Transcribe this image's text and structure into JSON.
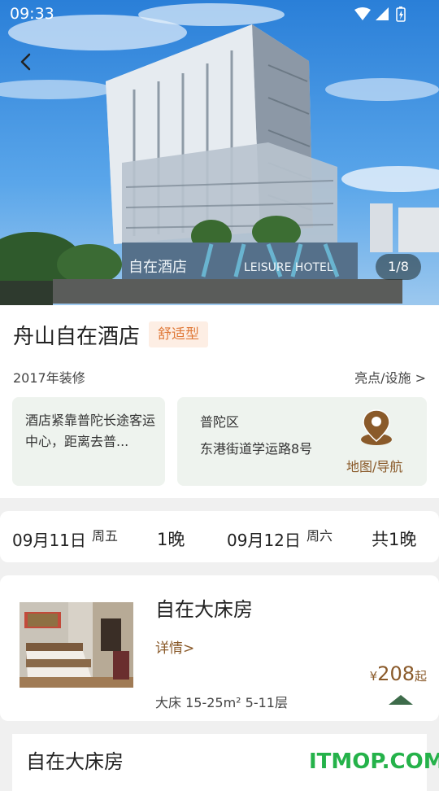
{
  "status_bar": {
    "time": "09:33"
  },
  "hero": {
    "photo_counter": "1/8",
    "sign_left": "自在酒店",
    "sign_right": "LEISURE HOTEL"
  },
  "hotel": {
    "name": "舟山自在酒店",
    "tag": "舒适型",
    "renovation": "2017年装修",
    "facilities_link": "亮点/设施 >",
    "description": "酒店紧靠普陀长途客运中心，距离去普...",
    "district": "普陀区",
    "street": "东港街道学运路8号",
    "map_label": "地图/导航"
  },
  "dates": {
    "checkin_date": "09月11日",
    "checkin_weekday": "周五",
    "nights": "1晚",
    "checkout_date": "09月12日",
    "checkout_weekday": "周六",
    "total": "共1晚"
  },
  "rooms": [
    {
      "name": "自在大床房",
      "detail_link": "详情>",
      "currency": "¥",
      "price": "208",
      "price_suffix": "起",
      "specs": "大床 15-25m² 5-11层"
    },
    {
      "name": "自在大床房"
    }
  ],
  "watermark": "ITMOP.COM",
  "colors": {
    "accent_brown": "#8a5a2a",
    "tag_orange": "#e07a3a",
    "card_green": "#eef3ee",
    "arrow_green": "#3d6b4a"
  }
}
